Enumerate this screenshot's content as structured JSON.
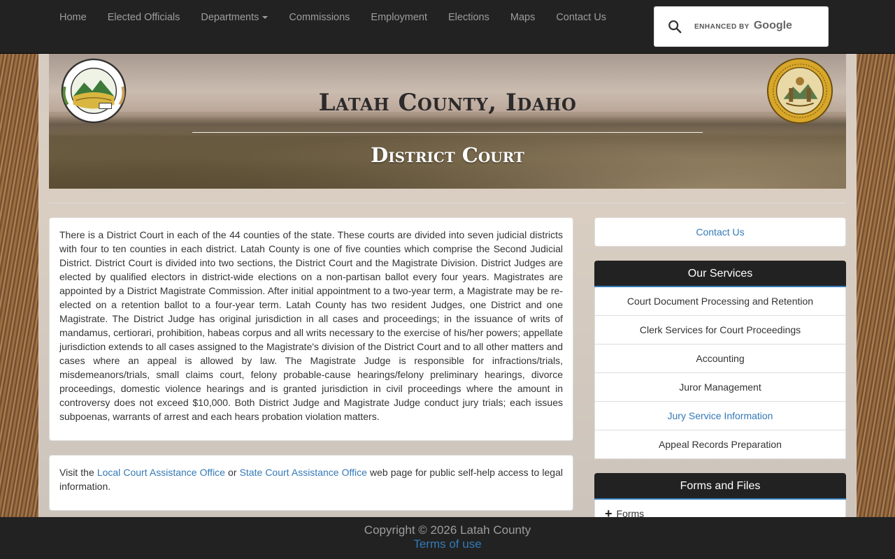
{
  "nav": {
    "items": [
      {
        "label": "Home"
      },
      {
        "label": "Elected Officials"
      },
      {
        "label": "Departments"
      },
      {
        "label": "Commissions"
      },
      {
        "label": "Employment"
      },
      {
        "label": "Elections"
      },
      {
        "label": "Maps"
      },
      {
        "label": "Contact Us"
      }
    ]
  },
  "search": {
    "brand_label": "ENHANCED BY",
    "brand_name": "Google"
  },
  "banner": {
    "title": "Latah County, Idaho",
    "subtitle": "District Court",
    "left_seal_icon": "latah-county-seal",
    "right_seal_icon": "idaho-state-seal"
  },
  "main": {
    "description": "There is a District Court in each of the 44 counties of the state. These courts are divided into seven judicial districts with four to ten counties in each district. Latah County is one of five counties which comprise the Second Judicial District. District Court is divided into two sections, the District Court and the Magistrate Division. District Judges are elected by qualified electors in district-wide elections on a non-partisan ballot every four years. Magistrates are appointed by a District Magistrate Commission. After initial appointment to a two-year term, a Magistrate may be re-elected on a retention ballot to a four-year term. Latah County has two resident Judges, one District and one Magistrate. The District Judge has original jurisdiction in all cases and proceedings; in the issuance of writs of mandamus, certiorari, prohibition, habeas corpus and all writs necessary to the exercise of his/her powers; appellate jurisdiction extends to all cases assigned to the Magistrate's division of the District Court and to all other matters and cases where an appeal is allowed by law. The Magistrate Judge is responsible for infractions/trials, misdemeanors/trials, small claims court, felony probable-cause hearings/felony preliminary hearings, divorce proceedings, domestic violence hearings and is granted jurisdiction in civil proceedings where the amount in controversy does not exceed $10,000. Both District Judge and Magistrate Judge conduct jury trials; each issues subpoenas, warrants of arrest and each hears probation violation matters.",
    "visit": {
      "prefix": "Visit the ",
      "link1": "Local Court Assistance Office",
      "middle": " or ",
      "link2": "State Court Assistance Office",
      "suffix": " web page for public self-help access to legal information."
    }
  },
  "sidebar": {
    "contact_label": "Contact Us",
    "services_heading": "Our Services",
    "services": [
      {
        "label": "Court Document Processing and Retention"
      },
      {
        "label": "Clerk Services for Court Proceedings"
      },
      {
        "label": "Accounting"
      },
      {
        "label": "Juror Management"
      },
      {
        "label": "Jury Service Information"
      },
      {
        "label": "Appeal Records Preparation"
      }
    ],
    "forms_heading": "Forms and Files",
    "forms_items": [
      {
        "label": "Forms"
      }
    ]
  },
  "footer": {
    "copyright": "Copyright © 2026 Latah County",
    "terms": "Terms of use"
  },
  "colors": {
    "navbar": "#222222",
    "link": "#337ab7",
    "nav_text": "#9d9d9d"
  }
}
